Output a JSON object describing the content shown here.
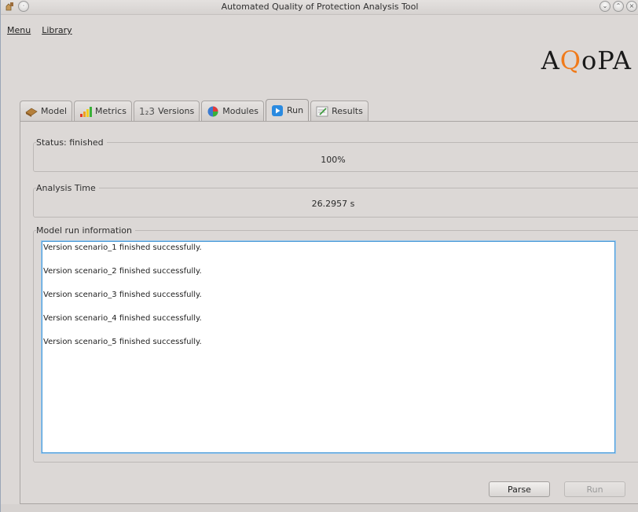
{
  "window": {
    "title": "Automated Quality of Protection Analysis Tool"
  },
  "menu": {
    "items": [
      {
        "label": "Menu"
      },
      {
        "label": "Library"
      }
    ]
  },
  "logo": {
    "pre": "A",
    "q": "Q",
    "post": "oPA"
  },
  "tabs": [
    {
      "label": "Model",
      "icon": "model-icon"
    },
    {
      "label": "Metrics",
      "icon": "metrics-icon"
    },
    {
      "label": "Versions",
      "icon": "versions-icon",
      "prefix": "1₂3"
    },
    {
      "label": "Modules",
      "icon": "modules-icon"
    },
    {
      "label": "Run",
      "icon": "run-icon",
      "active": true
    },
    {
      "label": "Results",
      "icon": "results-icon"
    }
  ],
  "status": {
    "label": "Status: finished",
    "value": "100%"
  },
  "analysis": {
    "label": "Analysis Time",
    "value": "26.2957 s"
  },
  "run_info": {
    "label": "Model run information",
    "lines": [
      "Version scenario_1 finished successfully.",
      "Version scenario_2 finished successfully.",
      "Version scenario_3 finished successfully.",
      "Version scenario_4 finished successfully.",
      "Version scenario_5 finished successfully."
    ]
  },
  "buttons": {
    "parse": "Parse",
    "run": "Run"
  },
  "colors": {
    "accent_blue": "#4a9ad8",
    "logo_orange": "#f07a1a",
    "background": "#dcd8d6"
  }
}
